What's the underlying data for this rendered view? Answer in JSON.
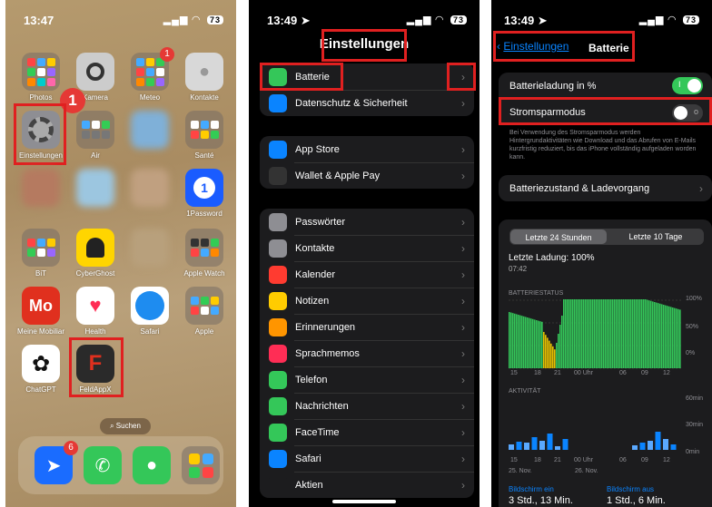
{
  "panel1": {
    "time": "13:47",
    "battery": "73",
    "apps": [
      {
        "label": "Photos"
      },
      {
        "label": "Kamera"
      },
      {
        "label": "Meteo",
        "badge": "1"
      },
      {
        "label": "Kontakte"
      },
      {
        "label": "Einstellungen",
        "badge": "1"
      },
      {
        "label": "Air"
      },
      {
        "label": ""
      },
      {
        "label": "Santé"
      },
      {
        "label": ""
      },
      {
        "label": ""
      },
      {
        "label": ""
      },
      {
        "label": "1Password"
      },
      {
        "label": "BiT"
      },
      {
        "label": "CyberGhost"
      },
      {
        "label": ""
      },
      {
        "label": "Apple Watch"
      },
      {
        "label": "Meine Mobiliar"
      },
      {
        "label": "Health"
      },
      {
        "label": "Safari"
      },
      {
        "label": "Apple"
      },
      {
        "label": "ChatGPT"
      },
      {
        "label": "FeldAppX"
      }
    ],
    "search": "Suchen",
    "dock_badge": "6"
  },
  "panel2": {
    "time": "13:49",
    "battery": "73",
    "title": "Einstellungen",
    "groups": [
      [
        {
          "label": "Batterie",
          "color": "#34c759",
          "icon": "battery-icon"
        },
        {
          "label": "Datenschutz & Sicherheit",
          "color": "#0a84ff",
          "icon": "hand-icon"
        }
      ],
      [
        {
          "label": "App Store",
          "color": "#0a84ff",
          "icon": "appstore-icon"
        },
        {
          "label": "Wallet & Apple Pay",
          "color": "#333333",
          "icon": "wallet-icon"
        }
      ],
      [
        {
          "label": "Passwörter",
          "color": "#8e8e93",
          "icon": "key-icon"
        },
        {
          "label": "Kontakte",
          "color": "#8e8e93",
          "icon": "contacts-icon"
        },
        {
          "label": "Kalender",
          "color": "#ff3b30",
          "icon": "calendar-icon"
        },
        {
          "label": "Notizen",
          "color": "#ffcc00",
          "icon": "notes-icon"
        },
        {
          "label": "Erinnerungen",
          "color": "#ff9500",
          "icon": "reminders-icon"
        },
        {
          "label": "Sprachmemos",
          "color": "#ff2d55",
          "icon": "voicememo-icon"
        },
        {
          "label": "Telefon",
          "color": "#34c759",
          "icon": "phone-icon"
        },
        {
          "label": "Nachrichten",
          "color": "#34c759",
          "icon": "messages-icon"
        },
        {
          "label": "FaceTime",
          "color": "#34c759",
          "icon": "facetime-icon"
        },
        {
          "label": "Safari",
          "color": "#0a84ff",
          "icon": "safari-icon"
        },
        {
          "label": "Aktien",
          "color": "#1c1c1e",
          "icon": "stocks-icon"
        }
      ]
    ]
  },
  "panel3": {
    "time": "13:49",
    "battery": "73",
    "back": "Einstellungen",
    "title": "Batterie",
    "row_percent": "Batterieladung in %",
    "row_saver": "Stromsparmodus",
    "note": "Bei Verwendung des Stromsparmodus werden Hintergrundaktivitäten wie Download und das Abrufen von E-Mails kurzfristig reduziert, bis das iPhone vollständig aufgeladen worden kann.",
    "row_health": "Batteriezustand & Ladevorgang",
    "seg": [
      "Letzte 24 Stunden",
      "Letzte 10 Tage"
    ],
    "last_charge": "Letzte Ladung: 100%",
    "last_time": "07:42",
    "status_label": "BATTERIESTATUS",
    "activity_label": "AKTIVITÄT",
    "pct": [
      "100%",
      "50%",
      "0%"
    ],
    "act": [
      "60min",
      "30min",
      "0min"
    ],
    "x_ticks": [
      "15",
      "18",
      "21",
      "00 Uhr",
      "06",
      "09",
      "12"
    ],
    "dates": [
      "25. Nov.",
      "26. Nov."
    ],
    "screen_on_label": "Bildschirm ein",
    "screen_on": "3 Std., 13 Min.",
    "screen_off_label": "Bildschirm aus",
    "screen_off": "1 Std., 6 Min."
  },
  "colors": {
    "highlight": "#e02020",
    "green": "#34c759",
    "blue": "#0a84ff",
    "yellow": "#e5c100"
  }
}
